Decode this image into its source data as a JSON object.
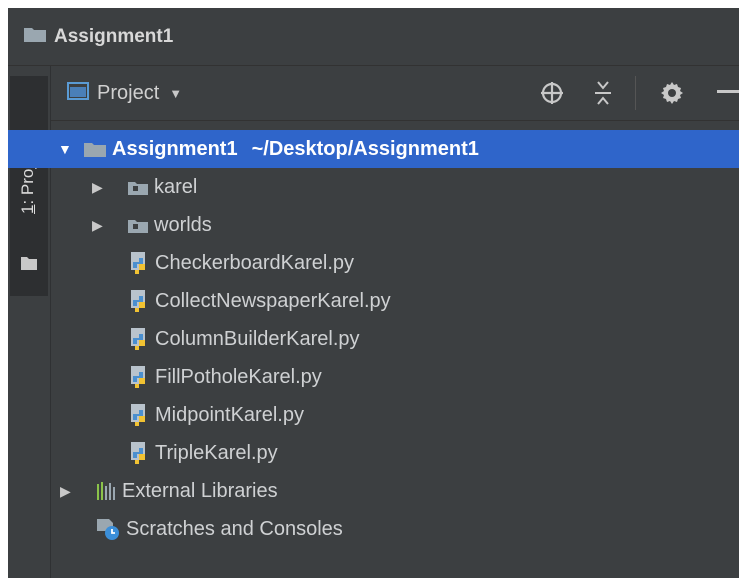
{
  "window": {
    "title": "Assignment1"
  },
  "side_tab": {
    "number": "1",
    "label": ": Project"
  },
  "panel": {
    "view_label": "Project",
    "dropdown": "▼"
  },
  "tree": {
    "root": {
      "name": "Assignment1",
      "path": "~/Desktop/Assignment1"
    },
    "folders": [
      {
        "name": "karel"
      },
      {
        "name": "worlds"
      }
    ],
    "files": [
      {
        "name": "CheckerboardKarel.py"
      },
      {
        "name": "CollectNewspaperKarel.py"
      },
      {
        "name": "ColumnBuilderKarel.py"
      },
      {
        "name": "FillPotholeKarel.py"
      },
      {
        "name": "MidpointKarel.py"
      },
      {
        "name": "TripleKarel.py"
      }
    ],
    "external_libraries": "External Libraries",
    "scratches": "Scratches and Consoles"
  },
  "colors": {
    "background": "#3c3f41",
    "selection": "#2f65ca",
    "text": "#cfd1d3",
    "folder": "#9aa7b0",
    "python_blue": "#4a8fcf",
    "python_yellow": "#f1c232"
  }
}
